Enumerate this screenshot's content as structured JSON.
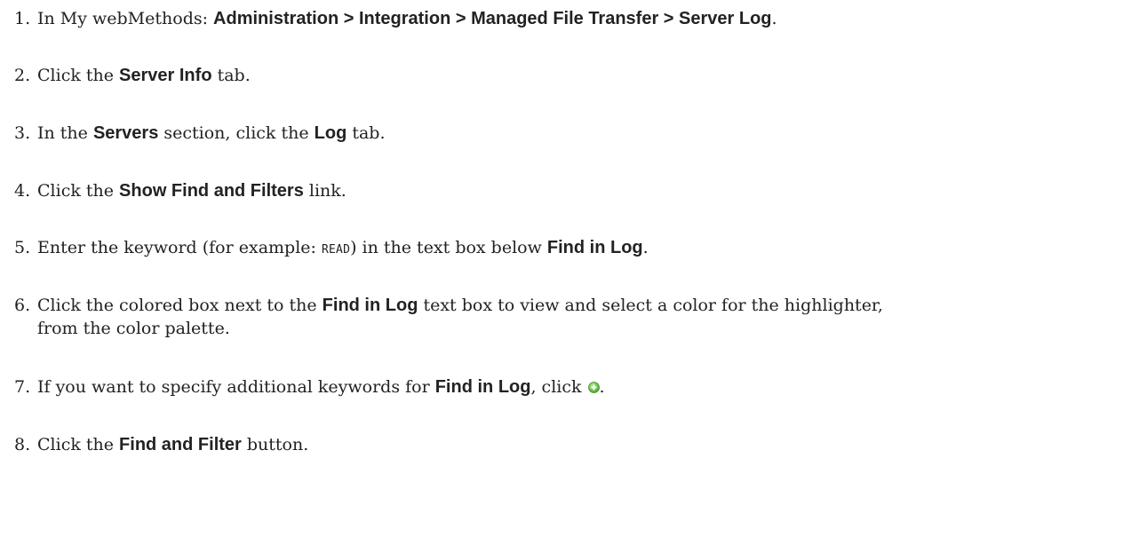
{
  "steps": [
    {
      "number": "1.",
      "text1": "In My webMethods: ",
      "bold1": "Administration > Integration > Managed File Transfer > Server Log",
      "text2": "."
    },
    {
      "number": "2.",
      "text1": "Click the ",
      "bold1": "Server Info",
      "text2": " tab."
    },
    {
      "number": "3.",
      "text1": "In the ",
      "bold1": "Servers",
      "text2": " section, click the ",
      "bold2": "Log",
      "text3": " tab."
    },
    {
      "number": "4.",
      "text1": "Click the ",
      "bold1": "Show Find and Filters",
      "text2": " link."
    },
    {
      "number": "5.",
      "text1": "Enter the keyword (for example: ",
      "code1": "READ",
      "text2": ") in the text box below ",
      "bold1": "Find in Log",
      "text3": "."
    },
    {
      "number": "6.",
      "text1": "Click the colored box next to the ",
      "bold1": "Find in Log",
      "text2": " text box to view and select a color for the highlighter, from the color palette."
    },
    {
      "number": "7.",
      "text1": "If you want to specify additional keywords for ",
      "bold1": "Find in Log",
      "text2": ", click ",
      "icon": "add-circle-icon",
      "text3": "."
    },
    {
      "number": "8.",
      "text1": "Click the ",
      "bold1": "Find and Filter",
      "text2": " button."
    }
  ],
  "colors": {
    "text": "#222222",
    "icon_fill": "#6cc04a"
  }
}
